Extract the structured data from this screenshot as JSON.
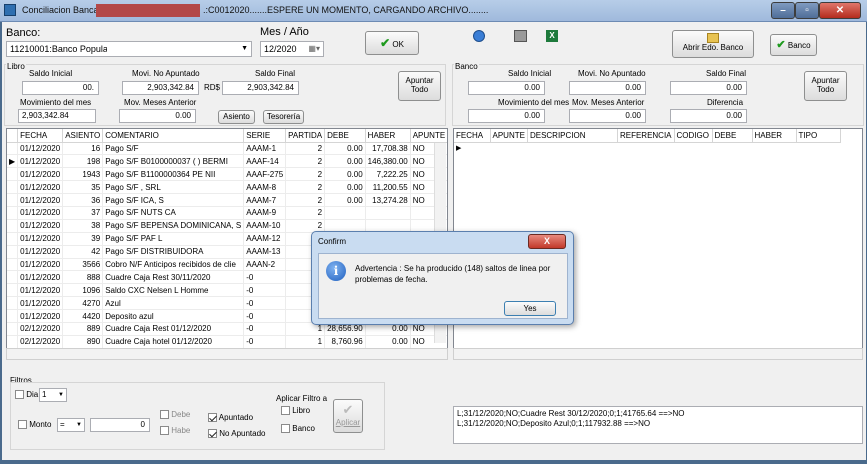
{
  "window": {
    "title": "Conciliacion Bancaria",
    "title_suffix": ".:C0012020.......ESPERE UN MOMENTO, CARGANDO ARCHIVO........",
    "min_label": "–",
    "max_label": "▫",
    "close_label": "✕"
  },
  "header": {
    "banco_label": "Banco:",
    "banco_value": "11210001:Banco Popular",
    "mes_label": "Mes / Año",
    "mes_value": "12/2020",
    "ok_label": "OK",
    "abrir_label": "Abrir Edo. Banco",
    "banco_button_label": "Banco"
  },
  "libro": {
    "group_label": "Libro",
    "saldo_inicial_label": "Saldo Inicial",
    "saldo_inicial": "00.",
    "movi_no_apuntado_label": "Movi. No Apuntado",
    "movi_no_apuntado": "2,903,342.84",
    "rd_label": "RD$",
    "saldo_final_label": "Saldo Final",
    "saldo_final": "2,903,342.84",
    "apuntar_todo_label": "Apuntar Todo",
    "movimiento_mes_label": "Movimiento del mes",
    "movimiento_mes": "2,903,342.84",
    "mov_meses_anterior_label": "Mov. Meses Anterior",
    "mov_meses_anterior": "0.00",
    "asiento_label": "Asiento",
    "tesoreria_label": "Tesorería"
  },
  "banco": {
    "group_label": "Banco",
    "saldo_inicial_label": "Saldo Inicial",
    "saldo_inicial": "0.00",
    "movi_no_apuntado_label": "Movi. No Apuntado",
    "movi_no_apuntado": "0.00",
    "saldo_final_label": "Saldo Final",
    "saldo_final": "0.00",
    "apuntar_todo_label": "Apuntar Todo",
    "movimiento_mes_label": "Movimiento del mes",
    "movimiento_mes": "0.00",
    "mov_meses_anterior_label": "Mov. Meses Anterior",
    "mov_meses_anterior": "0.00",
    "diferencia_label": "Diferencia",
    "diferencia": "0.00"
  },
  "left_grid": {
    "columns": [
      "FECHA",
      "ASIENTO",
      "COMENTARIO",
      "SERIE",
      "PARTIDA",
      "DEBE",
      "HABER",
      "APUNTE"
    ],
    "rows": [
      [
        "01/12/2020",
        "16",
        "Pago S/F",
        "AAAM-1",
        "2",
        "0.00",
        "17,708.38",
        "NO"
      ],
      [
        "01/12/2020",
        "198",
        "Pago S/F B0100000037 ( ) BERMI",
        "AAAF-14",
        "2",
        "0.00",
        "146,380.00",
        "NO"
      ],
      [
        "01/12/2020",
        "1943",
        "Pago S/F B1100000364 PE NII",
        "AAAF-275",
        "2",
        "0.00",
        "7,222.25",
        "NO"
      ],
      [
        "01/12/2020",
        "35",
        "Pago S/F , SRL",
        "AAAM-8",
        "2",
        "0.00",
        "11,200.55",
        "NO"
      ],
      [
        "01/12/2020",
        "36",
        "Pago S/F ICA, S",
        "AAAM-7",
        "2",
        "0.00",
        "13,274.28",
        "NO"
      ],
      [
        "01/12/2020",
        "37",
        "Pago S/F NUTS CA",
        "AAAM-9",
        "2",
        "",
        "",
        ""
      ],
      [
        "01/12/2020",
        "38",
        "Pago S/F BEPENSA DOMINICANA, S",
        "AAAM-10",
        "2",
        "",
        "",
        ""
      ],
      [
        "01/12/2020",
        "39",
        "Pago S/F PAF L",
        "AAAM-12",
        "2",
        "",
        "",
        ""
      ],
      [
        "01/12/2020",
        "42",
        "Pago S/F DISTRIBUIDORA",
        "AAAM-13",
        "2",
        "",
        "",
        ""
      ],
      [
        "01/12/2020",
        "3566",
        "Cobro N/F Anticipos recibidos de clie",
        "AAAN-2",
        "1",
        "",
        "",
        ""
      ],
      [
        "01/12/2020",
        "888",
        "Cuadre Caja Rest 30/11/2020",
        "-0",
        "1",
        "",
        "",
        ""
      ],
      [
        "01/12/2020",
        "1096",
        "Saldo CXC Nelsen L Homme",
        "-0",
        "1",
        "",
        "",
        ""
      ],
      [
        "01/12/2020",
        "4270",
        "Azul",
        "-0",
        "1",
        "",
        "",
        ""
      ],
      [
        "01/12/2020",
        "4420",
        "Deposito azul",
        "-0",
        "1",
        "6,032.55",
        "0.00",
        "NO"
      ],
      [
        "02/12/2020",
        "889",
        "Cuadre Caja Rest 01/12/2020",
        "-0",
        "1",
        "28,656.90",
        "0.00",
        "NO"
      ],
      [
        "02/12/2020",
        "890",
        "Cuadre Caja hotel 01/12/2020",
        "-0",
        "1",
        "8,760.96",
        "0.00",
        "NO"
      ]
    ]
  },
  "right_grid": {
    "columns": [
      "FECHA",
      "APUNTE",
      "DESCRIPCION",
      "REFERENCIA",
      "CODIGO",
      "DEBE",
      "HABER",
      "TIPO"
    ]
  },
  "dialog": {
    "title": "Confirm",
    "close_label": "X",
    "message": "Advertencia : Se ha producido (148) saltos de linea por problemas de fecha.",
    "yes_label": "Yes"
  },
  "filtros": {
    "label": "Filtros",
    "dia_label": "Dia",
    "dia_value": "1",
    "monto_label": "Monto",
    "monto_op": "=",
    "monto_value": "0",
    "debe_label": "Debe",
    "haber_label": "Habe",
    "apuntado_label": "Apuntado",
    "no_apuntado_label": "No Apuntado",
    "aplicar_filtro_label": "Aplicar Filtro a",
    "libro_label": "Libro",
    "banco_label": "Banco",
    "aplicar_label": "Aplicar"
  },
  "log": {
    "text": "L;31/12/2020;NO;Cuadre Rest 30/12/2020;0;1;41765.64 ==>NO\nL;31/12/2020;NO;Deposito Azul;0;1;117932.88 ==>NO"
  },
  "icons": [
    "app-icon",
    "check-icon",
    "help-icon",
    "print-icon",
    "excel-icon",
    "open-folder-icon",
    "info-icon"
  ]
}
